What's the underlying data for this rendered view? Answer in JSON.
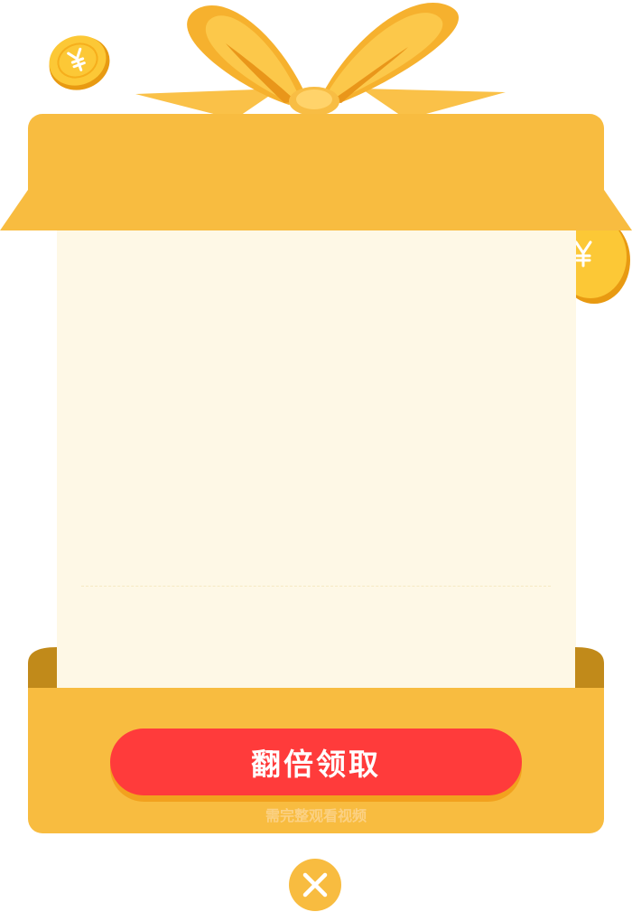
{
  "dialog": {
    "claim_label": "翻倍领取",
    "hint": "需完整观看视频"
  },
  "icons": {
    "coin": "yuan-coin-icon",
    "close": "close-icon",
    "bow": "gift-bow"
  },
  "colors": {
    "gift_gold": "#F8BC40",
    "card_bg": "#FEF8E6",
    "claim_red": "#FF3B3B",
    "ribbon": "#F9B232"
  }
}
